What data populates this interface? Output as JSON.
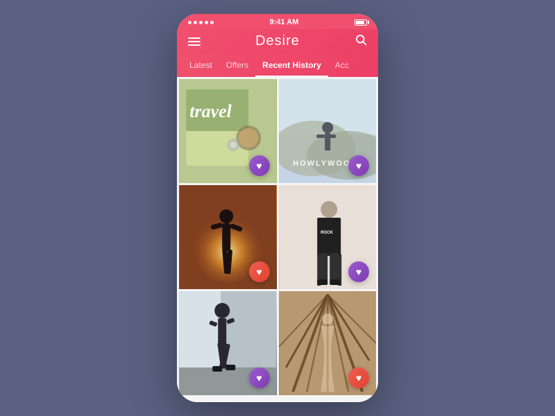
{
  "statusBar": {
    "time": "9:41 AM"
  },
  "header": {
    "title": "Desire",
    "searchLabel": "search"
  },
  "tabs": [
    {
      "id": "latest",
      "label": "Latest",
      "active": false
    },
    {
      "id": "offers",
      "label": "Offers",
      "active": false
    },
    {
      "id": "recent-history",
      "label": "Recent History",
      "active": true
    },
    {
      "id": "account",
      "label": "Acc",
      "active": false
    }
  ],
  "grid": {
    "items": [
      {
        "id": "travel",
        "type": "travel",
        "liked": false,
        "heartColor": "purple"
      },
      {
        "id": "hollywood",
        "type": "hollywood",
        "liked": false,
        "heartColor": "purple"
      },
      {
        "id": "silhouette",
        "type": "silhouette",
        "liked": true,
        "heartColor": "coral"
      },
      {
        "id": "fashion",
        "type": "fashion",
        "liked": false,
        "heartColor": "purple"
      },
      {
        "id": "walk",
        "type": "walk",
        "liked": false,
        "heartColor": "purple"
      },
      {
        "id": "wood",
        "type": "wood",
        "liked": false,
        "heartColor": "coral"
      }
    ]
  },
  "icons": {
    "hamburger": "☰",
    "search": "🔍",
    "heart": "♥"
  }
}
